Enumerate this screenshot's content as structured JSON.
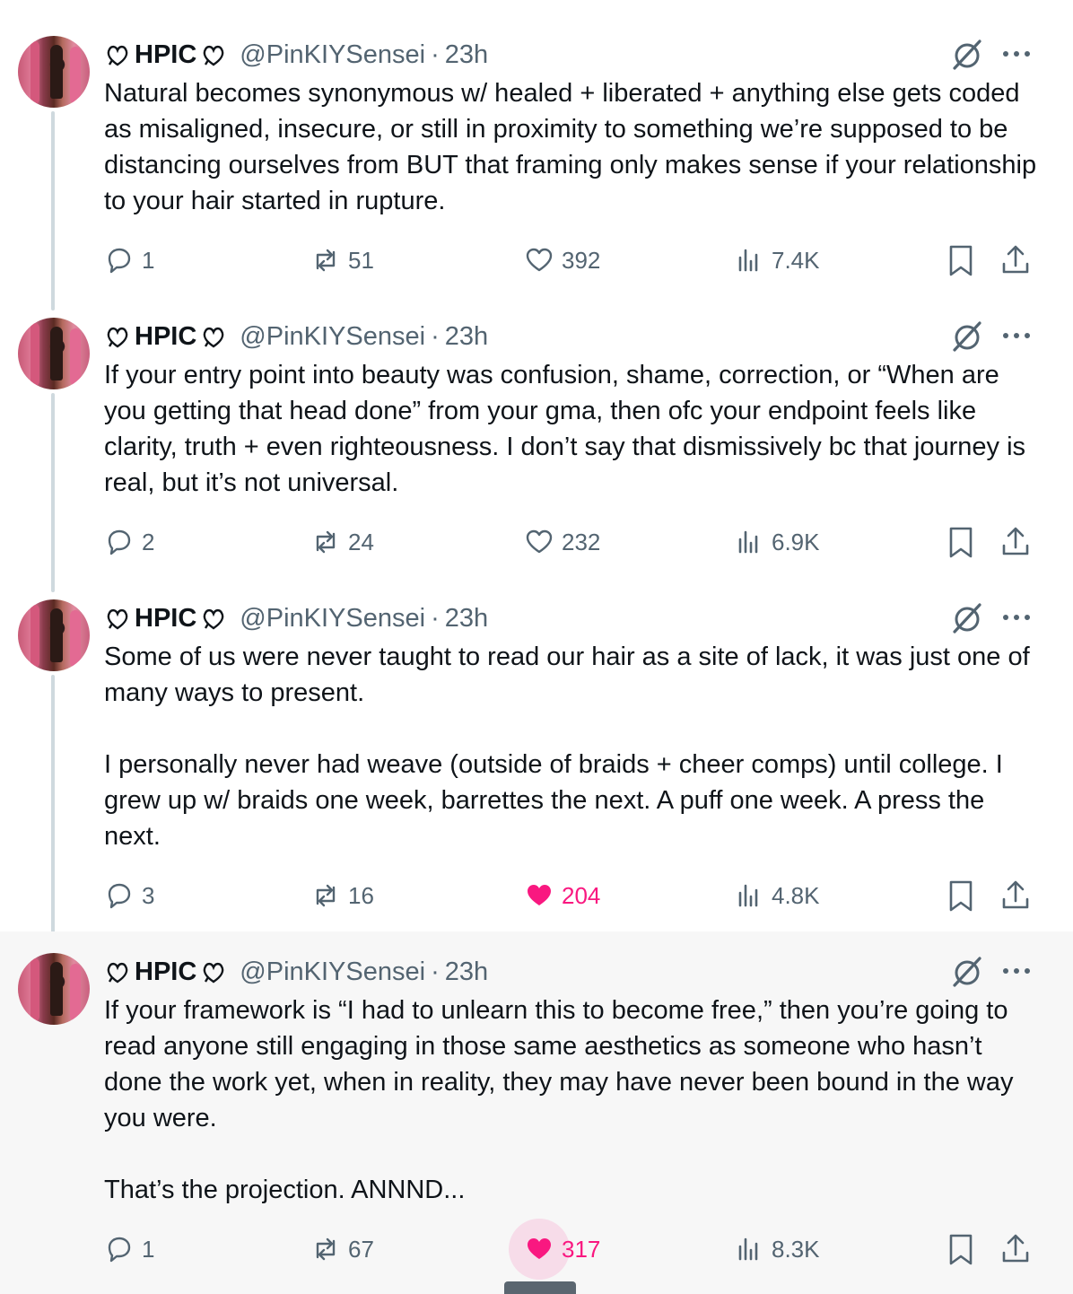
{
  "colors": {
    "accent_like": "#f91880",
    "muted": "#536471",
    "text": "#0f1419",
    "thread_line": "#cfd9de"
  },
  "author": {
    "name": "HPIC",
    "name_decoration_icon": "heart-knot-icon",
    "handle": "@PinKIYSensei",
    "separator": "·",
    "time": "23h"
  },
  "tweets": [
    {
      "text": "Natural becomes synonymous w/ healed + liberated + anything else gets coded as misaligned, insecure, or still in proximity to something we’re supposed to be distancing ourselves from BUT that framing only makes sense if your relationship to your hair started in rupture.",
      "replies": "1",
      "reposts": "51",
      "likes": "392",
      "views": "7.4K",
      "liked": false
    },
    {
      "text": "If your entry point into beauty was confusion, shame, correction, or “When are you getting that head done” from your gma, then ofc your endpoint feels like clarity, truth + even righteousness. I don’t say that dismissively bc that journey is real, but it’s not universal.",
      "replies": "2",
      "reposts": "24",
      "likes": "232",
      "views": "6.9K",
      "liked": false
    },
    {
      "text": "Some of us were never taught to read our hair as a site of lack, it was just one of many ways to present.\n\nI personally never had weave (outside of braids + cheer comps) until college. I grew up w/ braids one week, barrettes the next. A puff one week. A press the next.",
      "replies": "3",
      "reposts": "16",
      "likes": "204",
      "views": "4.8K",
      "liked": true
    },
    {
      "text": "If your framework is “I had to unlearn this to become free,” then you’re going to read anyone still engaging in those same aesthetics as someone who hasn’t done the work yet, when in reality, they may have never been bound in the way you were.\n\nThat’s the projection. ANNND...",
      "replies": "1",
      "reposts": "67",
      "likes": "317",
      "views": "8.3K",
      "liked": true
    }
  ]
}
